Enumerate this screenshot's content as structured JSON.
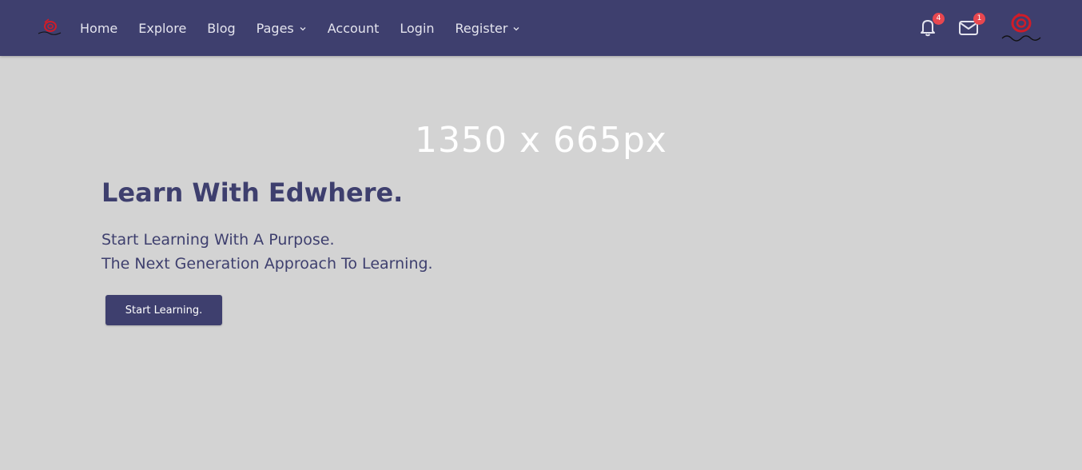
{
  "colors": {
    "navbar": "#3e3f6e",
    "background": "#d3d3d3",
    "primary": "#3e3f6e",
    "badge": "#e8474f"
  },
  "nav": {
    "brand_icon": "edwhere-logo-icon",
    "links": [
      {
        "label": "Home",
        "dropdown": false
      },
      {
        "label": "Explore",
        "dropdown": false
      },
      {
        "label": "Blog",
        "dropdown": false
      },
      {
        "label": "Pages",
        "dropdown": true
      },
      {
        "label": "Account",
        "dropdown": false
      },
      {
        "label": "Login",
        "dropdown": false
      },
      {
        "label": "Register",
        "dropdown": true
      }
    ],
    "notifications": {
      "icon": "bell-icon",
      "count": "4"
    },
    "messages": {
      "icon": "envelope-icon",
      "count": "1"
    },
    "avatar_icon": "user-avatar-logo"
  },
  "hero": {
    "placeholder": "1350 x 665px",
    "title": "Learn With Edwhere.",
    "subtitle_line1": "Start Learning With A Purpose.",
    "subtitle_line2": "The Next Generation Approach To Learning.",
    "cta_label": "Start Learning."
  }
}
